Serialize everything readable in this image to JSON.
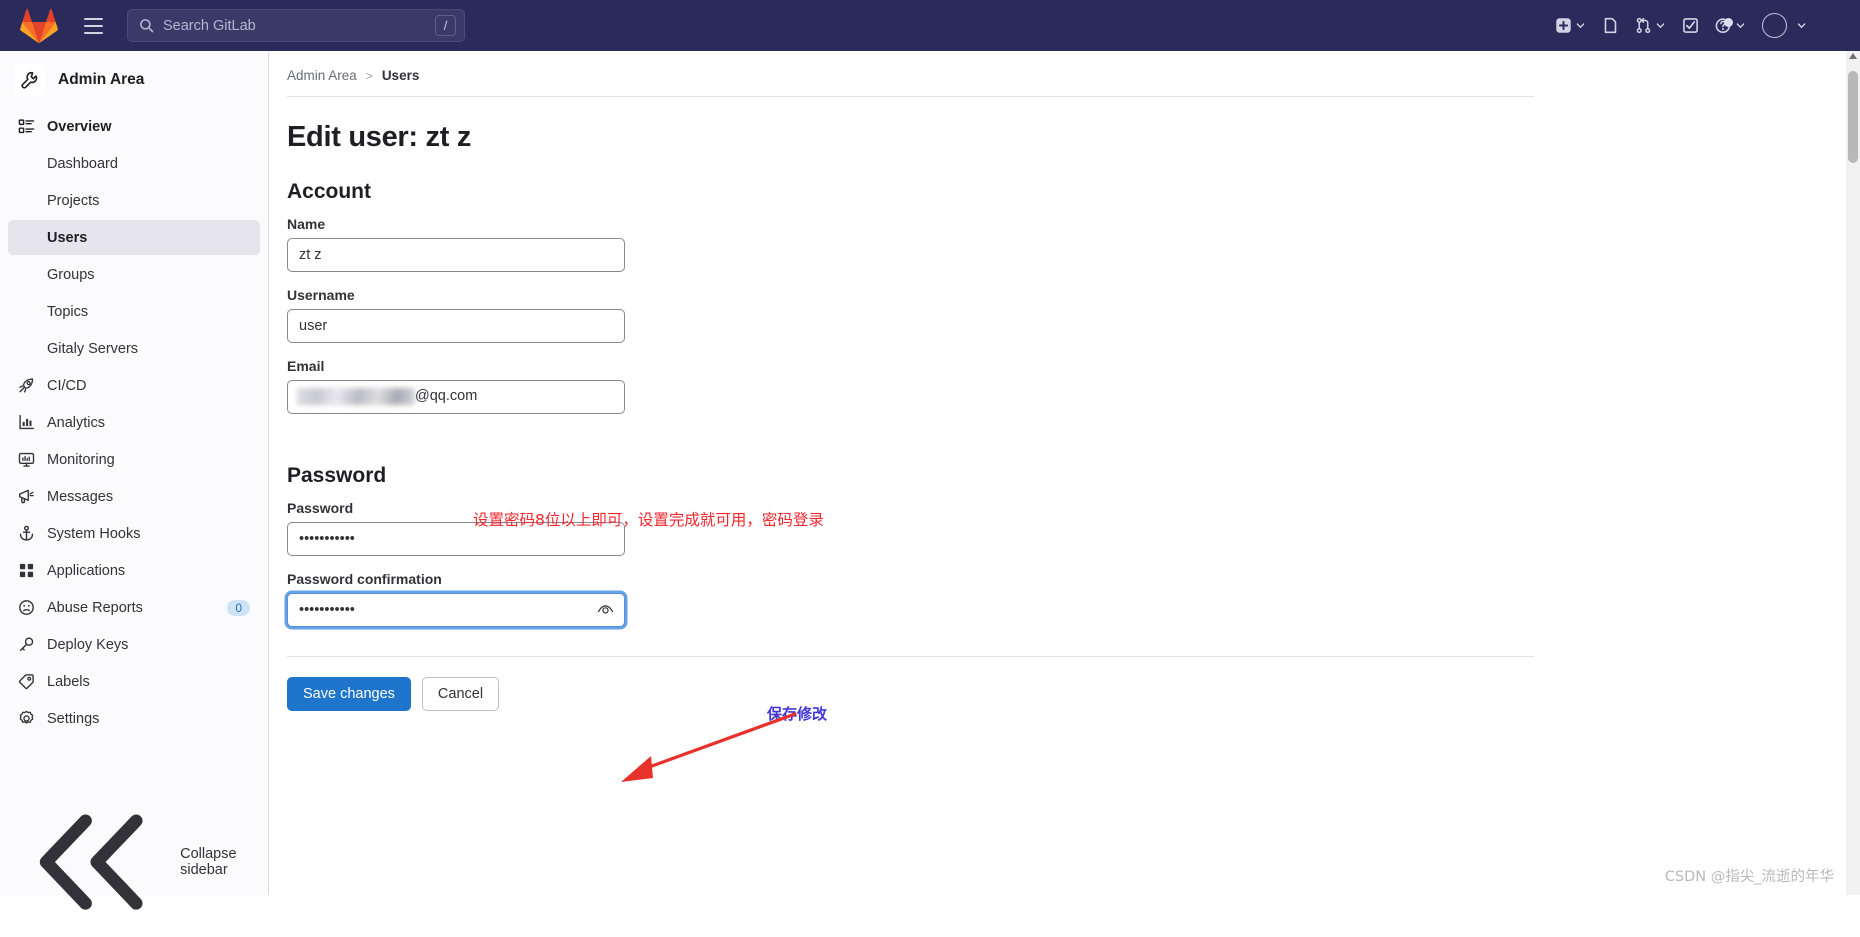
{
  "topbar": {
    "search": {
      "placeholder": "Search GitLab",
      "shortcut": "/",
      "icon": "search-icon"
    },
    "logo": "gitlab-logo",
    "menu_icon": "hamburger-menu-icon",
    "actions": [
      {
        "name": "create-new-menu",
        "icon": "plus-square-icon",
        "has_caret": true
      },
      {
        "name": "issues-link",
        "icon": "issues-icon",
        "has_caret": false
      },
      {
        "name": "merge-requests-menu",
        "icon": "merge-request-icon",
        "has_caret": true
      },
      {
        "name": "todos-link",
        "icon": "todo-check-icon",
        "has_caret": false
      },
      {
        "name": "help-menu",
        "icon": "question-circle-icon",
        "has_caret": true,
        "has_dot": true
      },
      {
        "name": "user-menu",
        "icon": "avatar",
        "has_caret": true
      }
    ]
  },
  "sidebar": {
    "title": "Admin Area",
    "title_icon": "wrench-icon",
    "items": [
      {
        "label": "Overview",
        "icon": "overview-icon",
        "type": "top"
      },
      {
        "label": "Dashboard",
        "icon": "",
        "type": "sub"
      },
      {
        "label": "Projects",
        "icon": "",
        "type": "sub"
      },
      {
        "label": "Users",
        "icon": "",
        "type": "sub",
        "active": true
      },
      {
        "label": "Groups",
        "icon": "",
        "type": "sub"
      },
      {
        "label": "Topics",
        "icon": "",
        "type": "sub"
      },
      {
        "label": "Gitaly Servers",
        "icon": "",
        "type": "sub"
      },
      {
        "label": "CI/CD",
        "icon": "rocket-icon",
        "type": "top"
      },
      {
        "label": "Analytics",
        "icon": "chart-icon",
        "type": "top"
      },
      {
        "label": "Monitoring",
        "icon": "monitor-icon",
        "type": "top"
      },
      {
        "label": "Messages",
        "icon": "megaphone-icon",
        "type": "top"
      },
      {
        "label": "System Hooks",
        "icon": "anchor-icon",
        "type": "top"
      },
      {
        "label": "Applications",
        "icon": "grid-icon",
        "type": "top"
      },
      {
        "label": "Abuse Reports",
        "icon": "sad-face-icon",
        "type": "top",
        "badge": "0"
      },
      {
        "label": "Deploy Keys",
        "icon": "key-icon",
        "type": "top"
      },
      {
        "label": "Labels",
        "icon": "tag-icon",
        "type": "top"
      },
      {
        "label": "Settings",
        "icon": "gear-icon",
        "type": "top"
      }
    ],
    "collapse": {
      "label": "Collapse sidebar",
      "icon": "chevron-double-left-icon"
    }
  },
  "breadcrumb": {
    "root": "Admin Area",
    "separator": ">",
    "current": "Users"
  },
  "page": {
    "title": "Edit user: zt z",
    "account_section": "Account",
    "password_section": "Password",
    "fields": {
      "name": {
        "label": "Name",
        "value": "zt z"
      },
      "username": {
        "label": "Username",
        "value": "user"
      },
      "email": {
        "label": "Email",
        "value_visible": "@qq.com",
        "redacted": true
      },
      "password": {
        "label": "Password",
        "value": "•••••••••••"
      },
      "password_confirmation": {
        "label": "Password confirmation",
        "value": "•••••••••••",
        "focused": true,
        "reveal_icon": "eye-icon"
      }
    },
    "buttons": {
      "save": "Save changes",
      "cancel": "Cancel"
    }
  },
  "annotations": {
    "password_note": "设置密码8位以上即可，设置完成就可用，密码登录",
    "password_note_color": "#f5262d",
    "save_note": "保存修改",
    "save_note_color": "#4238d8",
    "arrow_color": "#e8312a"
  },
  "watermark": "CSDN @指尖_流逝的年华"
}
